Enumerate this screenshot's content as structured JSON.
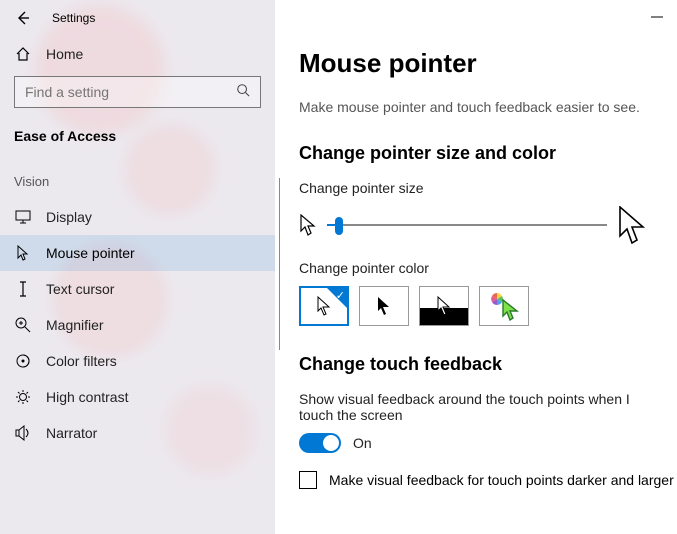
{
  "titlebar": {
    "app": "Settings"
  },
  "home": {
    "label": "Home"
  },
  "search": {
    "placeholder": "Find a setting"
  },
  "section": "Ease of Access",
  "group": "Vision",
  "nav": {
    "display": "Display",
    "mouse_pointer": "Mouse pointer",
    "text_cursor": "Text cursor",
    "magnifier": "Magnifier",
    "color_filters": "Color filters",
    "high_contrast": "High contrast",
    "narrator": "Narrator"
  },
  "page": {
    "title": "Mouse pointer",
    "desc": "Make mouse pointer and touch feedback easier to see.",
    "sec_size_color": "Change pointer size and color",
    "label_size": "Change pointer size",
    "label_color": "Change pointer color",
    "sec_touch": "Change touch feedback",
    "touch_desc": "Show visual feedback around the touch points when I touch the screen",
    "toggle_on": "On",
    "checkbox_label": "Make visual feedback for touch points darker and larger"
  }
}
